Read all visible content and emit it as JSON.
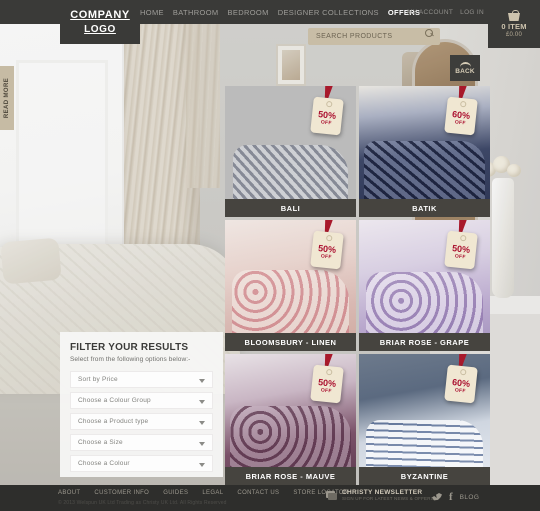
{
  "header": {
    "logo_line1": "COMPANY",
    "logo_line2": "LOGO",
    "nav": [
      {
        "label": "HOME",
        "active": false
      },
      {
        "label": "BATHROOM",
        "active": false
      },
      {
        "label": "BEDROOM",
        "active": false
      },
      {
        "label": "DESIGNER COLLECTIONS",
        "active": false
      },
      {
        "label": "OFFERS",
        "active": true
      }
    ],
    "account_links": [
      {
        "label": "MY ACCOUNT"
      },
      {
        "label": "LOG IN"
      }
    ],
    "search": {
      "placeholder": "SEARCH PRODUCTS",
      "value": "",
      "icon": "search-icon"
    },
    "cart": {
      "icon": "basket-icon",
      "items": "0 ITEM",
      "total": "£0.00"
    }
  },
  "side_tab": {
    "label": "READ MORE"
  },
  "back_button": {
    "label": "BACK",
    "icon": "chevron-up-icon"
  },
  "products": [
    {
      "name": "BALI",
      "badge_pct": "50%",
      "badge_off": "OFF",
      "photo_class": "ph-bali"
    },
    {
      "name": "BATIK",
      "badge_pct": "60%",
      "badge_off": "OFF",
      "photo_class": "ph-batik"
    },
    {
      "name": "BLOOMSBURY - LINEN",
      "badge_pct": "50%",
      "badge_off": "OFF",
      "photo_class": "ph-bloom"
    },
    {
      "name": "BRIAR ROSE - GRAPE",
      "badge_pct": "50%",
      "badge_off": "OFF",
      "photo_class": "ph-briargrape"
    },
    {
      "name": "BRIAR ROSE - MAUVE",
      "badge_pct": "50%",
      "badge_off": "OFF",
      "photo_class": "ph-briarmauve"
    },
    {
      "name": "BYZANTINE",
      "badge_pct": "60%",
      "badge_off": "OFF",
      "photo_class": "ph-byz"
    }
  ],
  "filter": {
    "title": "FILTER YOUR RESULTS",
    "subtitle": "Select from the following options below:-",
    "dropdowns": [
      {
        "label": "Sort by Price"
      },
      {
        "label": "Choose a Colour Group"
      },
      {
        "label": "Choose a Product type"
      },
      {
        "label": "Choose a Size"
      },
      {
        "label": "Choose a Colour"
      }
    ]
  },
  "footer": {
    "links": [
      {
        "label": "ABOUT"
      },
      {
        "label": "CUSTOMER INFO"
      },
      {
        "label": "GUIDES"
      },
      {
        "label": "LEGAL"
      },
      {
        "label": "CONTACT US"
      },
      {
        "label": "STORE LOCATOR"
      }
    ],
    "copyright": "© 2013 Welspun UK Ltd Trading as Christy UK Ltd. All Rights Reserved",
    "newsletter": {
      "icon": "newsletter-icon",
      "title": "CHRISTY NEWSLETTER",
      "subtitle": "SIGN UP FOR LATEST NEWS & OFFERS"
    },
    "social": [
      {
        "name": "twitter-icon"
      },
      {
        "name": "facebook-icon"
      }
    ],
    "blog_label": "BLOG"
  },
  "colors": {
    "dark": "#3a3a38",
    "footer": "#2e2e2c",
    "search_field": "#c8bda6",
    "tag_red": "#ab1130",
    "accent_tan": "#cdc3ad"
  }
}
